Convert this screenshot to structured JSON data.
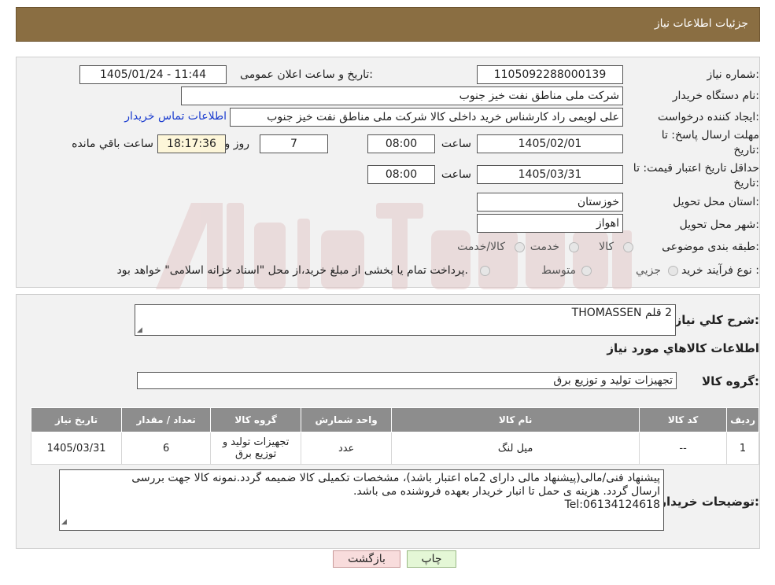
{
  "header": {
    "title": "جزئیات اطلاعات نیاز"
  },
  "form": {
    "need_number_label": "شماره نیاز:",
    "need_number": "1105092288000139",
    "announce_label": "تاریخ و ساعت اعلان عمومی:",
    "announce_value": "1405/01/24 - 11:44",
    "buyer_org_label": "نام دستگاه خریدار:",
    "buyer_org": "شرکت ملی مناطق نفت خیز جنوب",
    "requester_label": "ایجاد کننده درخواست:",
    "requester": "علی  لویمی راد  کارشناس خرید داخلی کالا شرکت ملی مناطق نفت خیز جنوب",
    "contact_link": "اطلاعات تماس خریدار",
    "deadline_label_1": "مهلت ارسال پاسخ: تا",
    "deadline_label_2": "تاریخ:",
    "deadline_date": "1405/02/01",
    "time_label": "ساعت",
    "deadline_time": "08:00",
    "deadline_days": "7",
    "days_label": "روز و",
    "remaining_time": "18:17:36",
    "remaining_label": "ساعت باقي مانده",
    "validity_label_1": "حداقل تاریخ اعتبار قیمت: تا",
    "validity_label_2": "تاریخ:",
    "validity_date": "1405/03/31",
    "validity_time": "08:00",
    "province_label": "استان محل تحویل:",
    "province": "خوزستان",
    "city_label": "شهر محل تحویل:",
    "city": "اهواز",
    "category_label": "طبقه بندی موضوعی:",
    "category_options": [
      "کالا",
      "خدمت",
      "کالا/خدمت"
    ],
    "process_label": "نوع فرآیند خرید :",
    "process_options": [
      "جزیي",
      "متوسط"
    ],
    "process_note": "پرداخت تمام یا بخشی از مبلغ خرید،از محل \"اسناد خزانه اسلامی\" خواهد بود."
  },
  "summary": {
    "title": "شرح كلي نياز:",
    "value": "2 قلم THOMASSEN"
  },
  "goods": {
    "section_title": "اطلاعات کالاهاي مورد نياز",
    "group_label": "گروه کالا:",
    "group_value": "تجهیزات تولید و توزیع برق",
    "columns": [
      "رديف",
      "کد کالا",
      "نام کالا",
      "واحد شمارش",
      "گروه کالا",
      "تعداد / مقدار",
      "تاریخ نیاز"
    ],
    "rows": [
      [
        "1",
        "--",
        "میل لنگ",
        "عدد",
        "تجهیزات تولید و توزیع برق",
        "6",
        "1405/03/31"
      ]
    ]
  },
  "buyer_notes": {
    "label": "توضیحات خریدار:",
    "lines": [
      "پیشنهاد فنی/مالی(پیشنهاد مالی دارای 2ماه اعتبار باشد)، مشخصات تکمیلی کالا ضمیمه گردد.نمونه کالا جهت بررسی",
      "ارسال گردد. هزینه ی حمل تا انبار خریدار بعهده فروشنده می باشد.",
      "Tel:06134124618"
    ]
  },
  "buttons": {
    "print": "چاپ",
    "back": "بازگشت"
  },
  "colors": {
    "header_bg": "#8a6e42",
    "table_header_bg": "#8d8d8d",
    "link": "#1a3ccf"
  }
}
